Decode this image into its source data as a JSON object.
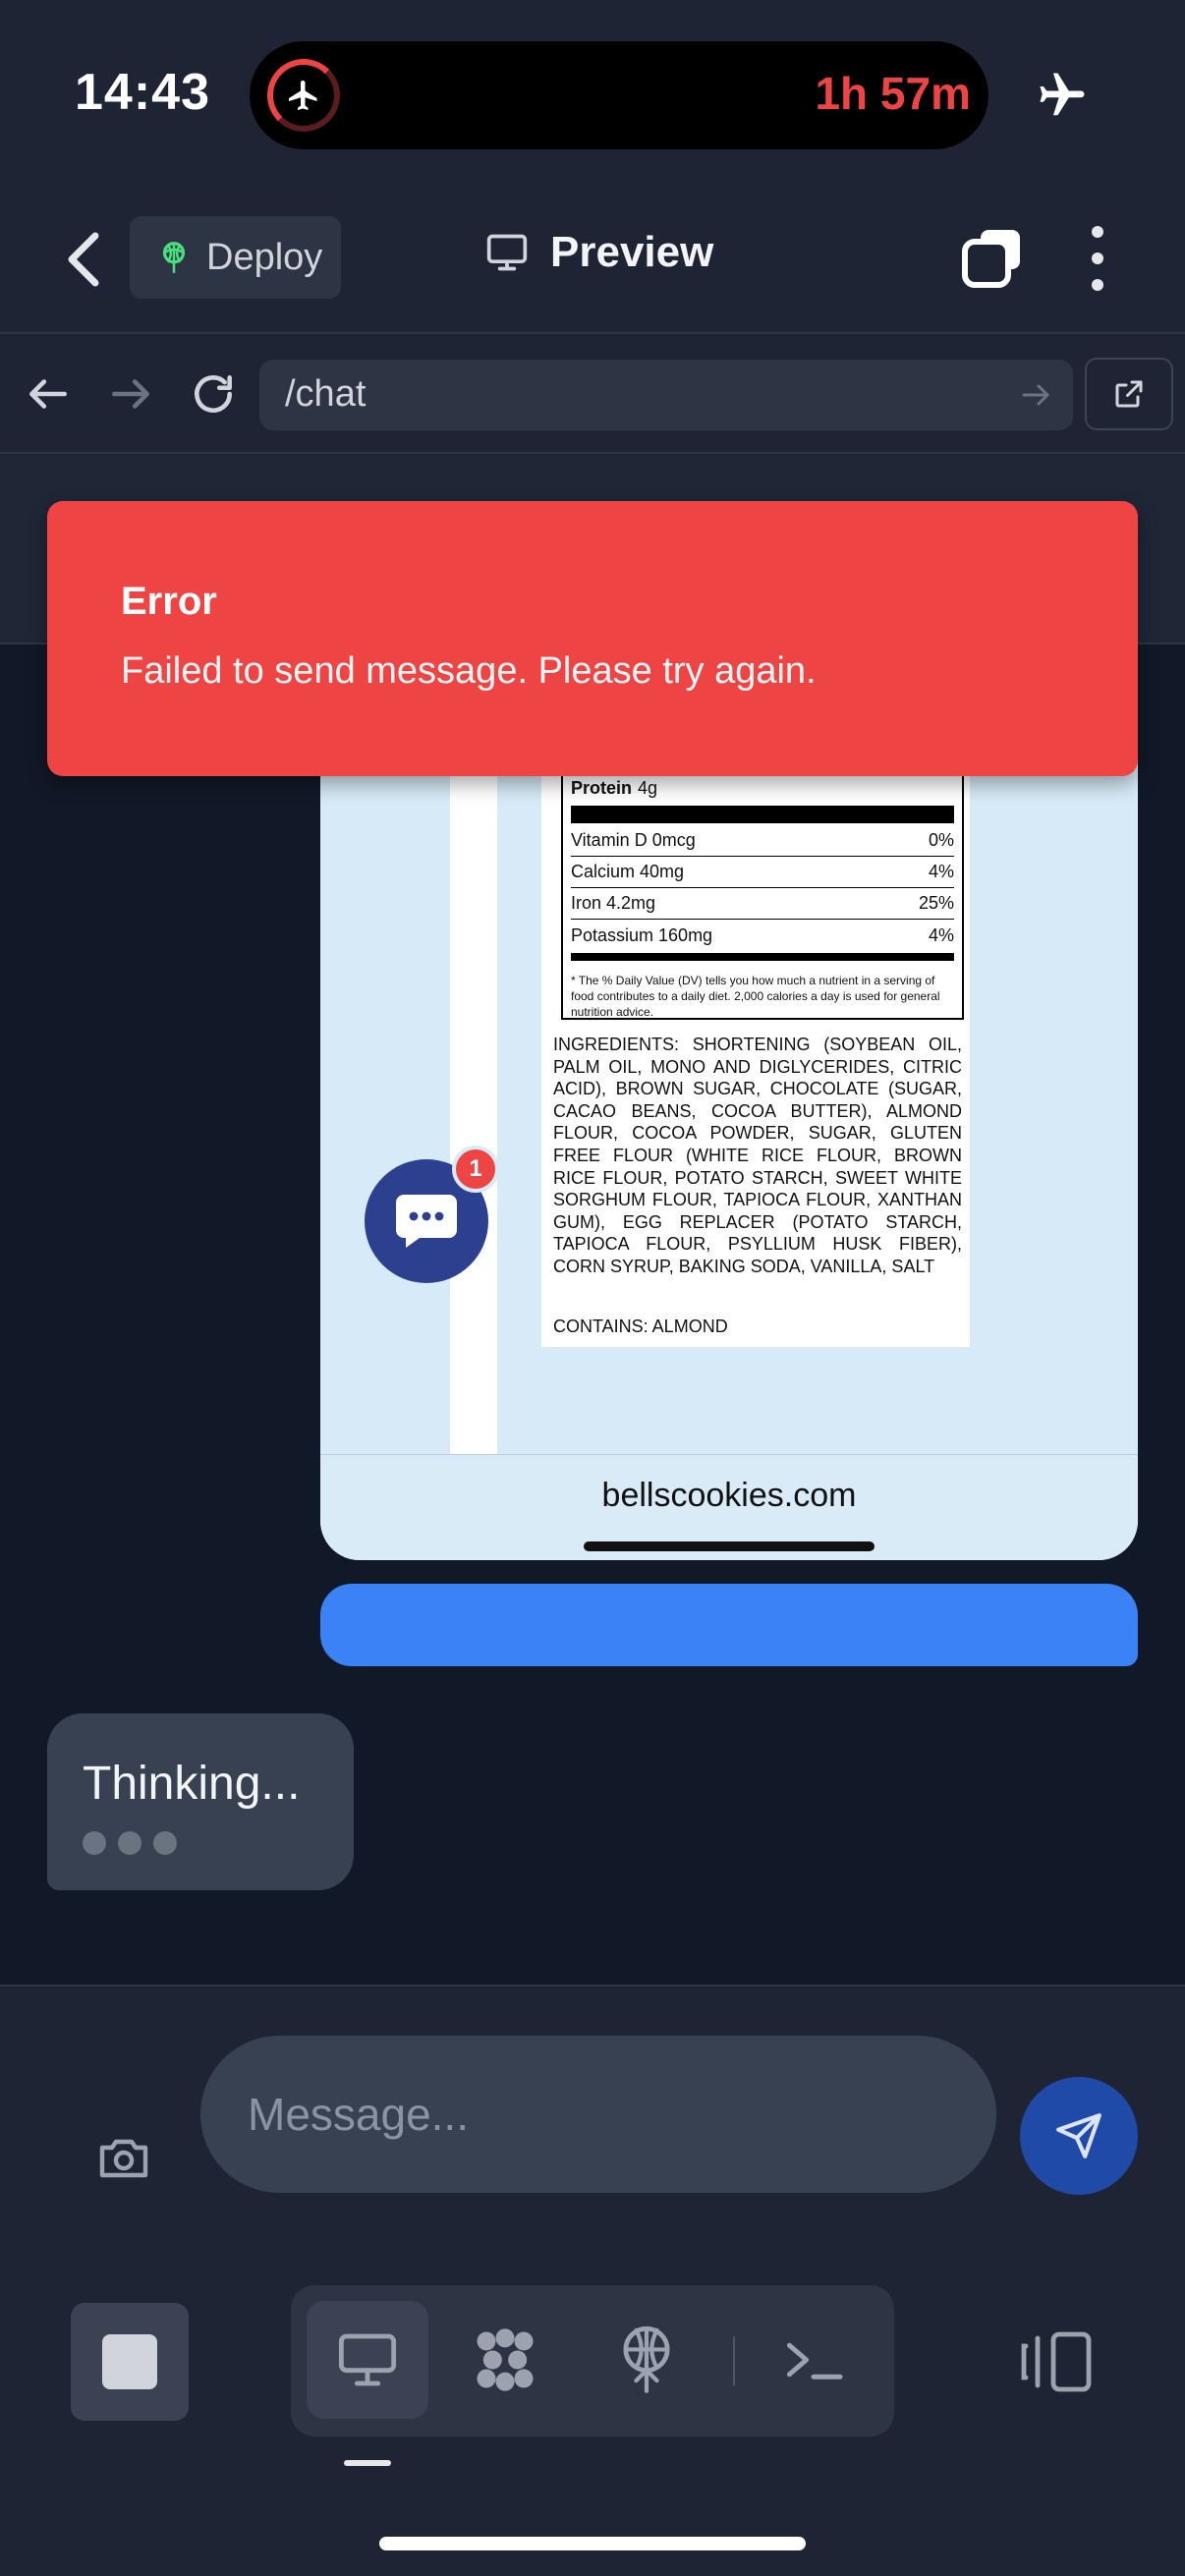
{
  "status_bar": {
    "time": "14:43",
    "timer": "1h 57m",
    "icons": [
      "airplane-mode-icon",
      "airplane-activity-icon"
    ]
  },
  "header": {
    "deploy_label": "Deploy",
    "preview_label": "Preview"
  },
  "url_bar": {
    "path": "/chat"
  },
  "toast": {
    "title": "Error",
    "message": "Failed to send message. Please try again."
  },
  "nutrition_label": {
    "protein_label": "Protein",
    "protein_value": "4g",
    "rows": [
      {
        "name": "Vitamin D 0mcg",
        "dv": "0%"
      },
      {
        "name": "Calcium 40mg",
        "dv": "4%"
      },
      {
        "name": "Iron 4.2mg",
        "dv": "25%"
      },
      {
        "name": "Potassium 160mg",
        "dv": "4%"
      }
    ],
    "footnote": "* The % Daily Value (DV) tells you how much a nutrient in a serving of food contributes to a daily diet. 2,000 calories a day is used for general nutrition advice.",
    "ingredients": "INGREDIENTS: SHORTENING (SOYBEAN OIL, PALM OIL, MONO AND DIGLYCERIDES, CITRIC ACID), BROWN SUGAR, CHOCOLATE (SUGAR, CACAO BEANS, COCOA BUTTER), ALMOND FLOUR, COCOA POWDER, SUGAR, GLUTEN FREE FLOUR (WHITE RICE FLOUR, BROWN RICE FLOUR, POTATO STARCH, SWEET WHITE SORGHUM FLOUR, TAPIOCA FLOUR, XANTHAN GUM), EGG REPLACER (POTATO STARCH, TAPIOCA FLOUR, PSYLLIUM HUSK FIBER), CORN SYRUP, BAKING SODA, VANILLA, SALT",
    "contains": "CONTAINS: ALMOND"
  },
  "screenshot_site": "bellscookies.com",
  "chat_widget": {
    "badge_count": "1"
  },
  "thinking": {
    "label": "Thinking..."
  },
  "composer": {
    "placeholder": "Message..."
  },
  "colors": {
    "error": "#ef4444",
    "accent": "#3b82f6",
    "background": "#111827"
  }
}
